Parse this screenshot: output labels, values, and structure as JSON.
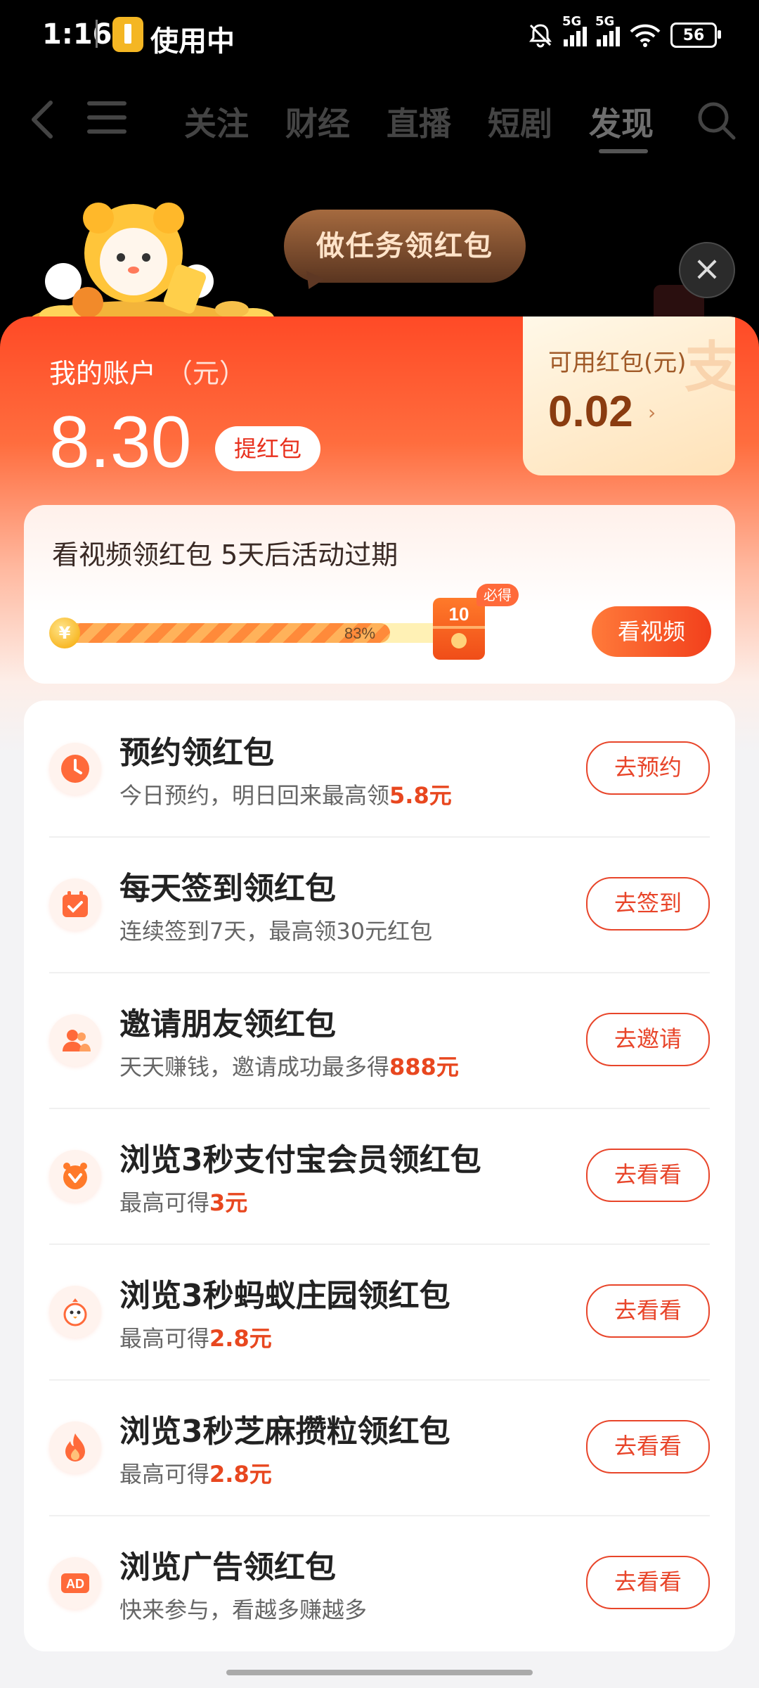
{
  "status_bar": {
    "time": "1:16",
    "app_status": "使用中",
    "network1": "5G",
    "network2": "5G",
    "battery": "56"
  },
  "nav": {
    "tabs": [
      "关注",
      "财经",
      "直播",
      "短剧",
      "发现"
    ],
    "active_tab": "发现"
  },
  "banner": {
    "bubble_text": "做任务领红包"
  },
  "account": {
    "title": "我的账户",
    "unit": "（元）",
    "amount": "8.30",
    "withdraw_label": "提红包"
  },
  "available": {
    "title": "可用红包(元)",
    "amount": "0.02",
    "arrow": "›",
    "watermark": "支"
  },
  "video_task": {
    "title": "看视频领红包 5天后活动过期",
    "progress_percent": 83,
    "progress_label": "83%",
    "coin_symbol": "¥",
    "reward": "10",
    "must_tag": "必得",
    "button": "看视频"
  },
  "tasks": [
    {
      "icon": "clock-icon",
      "title": "预约领红包",
      "sub_prefix": "今日预约，明日回来最高领",
      "sub_highlight": "5.8元",
      "button": "去预约"
    },
    {
      "icon": "calendar-check-icon",
      "title": "每天签到领红包",
      "sub_prefix": "连续签到7天，最高领30元红包",
      "sub_highlight": "",
      "button": "去签到"
    },
    {
      "icon": "friends-icon",
      "title": "邀请朋友领红包",
      "sub_prefix": "天天赚钱，邀请成功最多得",
      "sub_highlight": "888元",
      "button": "去邀请"
    },
    {
      "icon": "alipay-member-icon",
      "title": "浏览3秒支付宝会员领红包",
      "sub_prefix": "最高可得",
      "sub_highlight": "3元",
      "button": "去看看"
    },
    {
      "icon": "chick-icon",
      "title": "浏览3秒蚂蚁庄园领红包",
      "sub_prefix": "最高可得",
      "sub_highlight": "2.8元",
      "button": "去看看"
    },
    {
      "icon": "flame-icon",
      "title": "浏览3秒芝麻攒粒领红包",
      "sub_prefix": "最高可得",
      "sub_highlight": "2.8元",
      "button": "去看看"
    },
    {
      "icon": "ad-icon",
      "title": "浏览广告领红包",
      "sub_prefix": "快来参与，看越多赚越多",
      "sub_highlight": "",
      "button": "去看看"
    }
  ],
  "colors": {
    "accent_red": "#e8452a",
    "highlight": "#e8471f",
    "header_red": "#ff4a26"
  }
}
